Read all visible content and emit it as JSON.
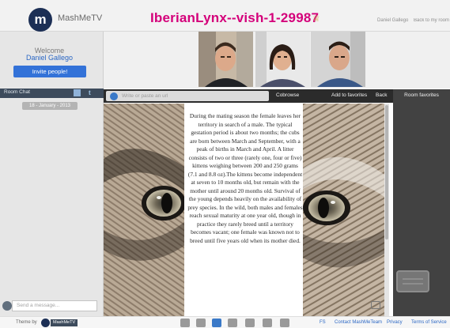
{
  "header": {
    "logo_letter": "m",
    "app_name": "MashMeTV",
    "room_title": "IberianLynx--vish-1-29987",
    "user_link": "Daniel Gallego",
    "back_link": "Back to my room"
  },
  "sidebar": {
    "welcome_label": "Welcome",
    "user_name": "Daniel Gallego",
    "invite_button": "Invite people!",
    "chat_title": "Room Chat",
    "chat_date": "18 - January - 2013",
    "chat_input_placeholder": "Send a message..."
  },
  "toolbar": {
    "url_placeholder": "Write or paste an url",
    "cobrowse": "Cobrowse",
    "add_favorites": "Add to favorites",
    "back": "Back",
    "room_favorites": "Room favorites"
  },
  "article": {
    "text": "During the mating season the female leaves her territory in search of a male. The typical gestation period is about two months; the cubs are born between March and September, with a peak of births in March and April. A litter consists of two or three (rarely one, four or five) kittens weighing between 200 and 250 grams (7.1 and 8.8 oz).The kittens become independent at seven to 10 months old, but remain with the mother until around 20 months old. Survival of the young depends heavily on the availability of prey species. In the wild, both males and females reach sexual maturity at one year old, though in practice they rarely breed until a territory becomes vacant; one female was known not to breed until five years old when its mother died."
  },
  "footer": {
    "theme_label": "Theme by",
    "theme_badge": "MashMeTV",
    "links": [
      "FS",
      "Contact MashMeTeam",
      "Privacy",
      "Terms of Service"
    ]
  },
  "colors": {
    "title_magenta": "#d4007a",
    "link_blue": "#2b67c4",
    "invite_blue": "#3372d8",
    "toolbar_dark": "#2b2b2b"
  }
}
